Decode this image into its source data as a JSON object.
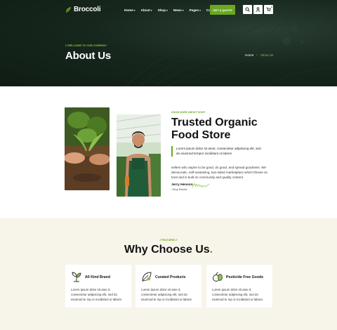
{
  "header": {
    "brand": "Broccoli",
    "nav": [
      "Home",
      "About",
      "Shop",
      "News",
      "Pages",
      "Contact"
    ],
    "nav_has_caret": [
      true,
      true,
      true,
      true,
      true,
      false
    ],
    "cta_label": "GET A QUOTE",
    "cart_count": "0",
    "colors": {
      "accent": "#6aa820",
      "hero_bg": "#13231a"
    }
  },
  "hero": {
    "subtitle": "// WELCOME TO OUR COMPANY",
    "title": "About Us",
    "breadcrumb": {
      "home": "Home",
      "separator": "/",
      "current": "About Us"
    }
  },
  "about": {
    "kicker": "KNOW MORE ABOUT SHOP",
    "title": "Trusted Organic Food Store",
    "quote": "Lorem ipsum dolor sit amet, consectetur adipiscing elit, sed do eiusmod tempor incididunt ut labore",
    "body": "sellers who aspire to be good, do good, and spread goodness. We democratic, self-sustaining, two-sided marketplace which thrives on trust and is built on community and quality content.",
    "signer_name": "Jerry Henson",
    "signer_role": "/ Shop Director"
  },
  "why": {
    "kicker": "// FEATURES //",
    "title": "Why Choose Us",
    "title_dot": ".",
    "cards": [
      {
        "icon": "sprout-icon",
        "title": "All Kind Brand",
        "text": "Lorem ipsum dolor sit ame it, consectetur adipiscing elit, sed do eiusmod te mp or incididunt ut labore."
      },
      {
        "icon": "leaf-icon",
        "title": "Curated Products",
        "text": "Lorem ipsum dolor sit ame it, consectetur adipiscing elit, sed do eiusmod te mp or incididunt ut labore."
      },
      {
        "icon": "vegetables-icon",
        "title": "Pesticide Free Goods",
        "text": "Lorem ipsum dolor sit ame it, consectetur adipiscing elit, sed do eiusmod te mp or incididunt ut labore."
      }
    ]
  }
}
